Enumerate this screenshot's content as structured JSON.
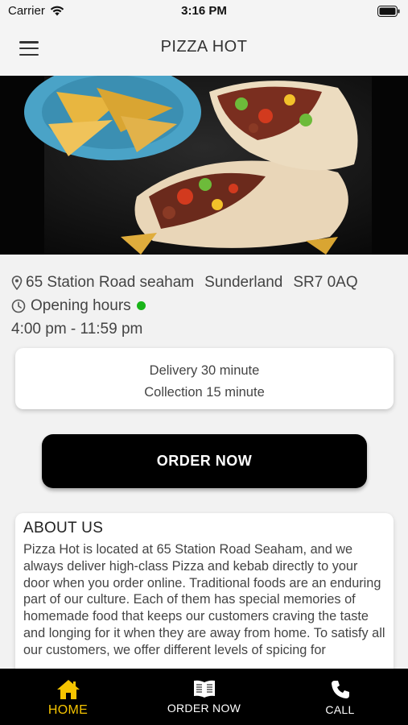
{
  "status_bar": {
    "carrier": "Carrier",
    "time": "3:16 PM"
  },
  "header": {
    "title": "PIZZA HOT",
    "menu_icon": "hamburger-menu-icon"
  },
  "hero": {
    "image_subject": "kebab wrap with nachos"
  },
  "info": {
    "address_parts": [
      "65 Station Road seaham",
      "Sunderland",
      "SR7 0AQ"
    ],
    "opening_label": "Opening hours",
    "open_status_color": "#19b419",
    "hours": "4:00 pm - 11:59 pm"
  },
  "delivery": {
    "delivery_text": "Delivery 30 minute",
    "collection_text": "Collection 15 minute"
  },
  "order_button": {
    "label": "ORDER NOW"
  },
  "about": {
    "title": "ABOUT US",
    "text": "Pizza Hot is located at 65 Station Road Seaham, and we always deliver high-class Pizza and kebab directly to your door when you order online. Traditional foods are an enduring part of our culture. Each of them has special memories of homemade food that keeps our customers craving the taste and longing for it when they are away from home.  To satisfy all our customers, we offer different levels of spicing for"
  },
  "tabs": [
    {
      "label": "HOME",
      "icon": "home-icon",
      "active": true
    },
    {
      "label": "ORDER NOW",
      "icon": "menu-book-icon",
      "active": false
    },
    {
      "label": "CALL",
      "icon": "phone-icon",
      "active": false
    }
  ],
  "colors": {
    "accent": "#f5c400",
    "tab_bar": "#000000",
    "button": "#000000"
  }
}
